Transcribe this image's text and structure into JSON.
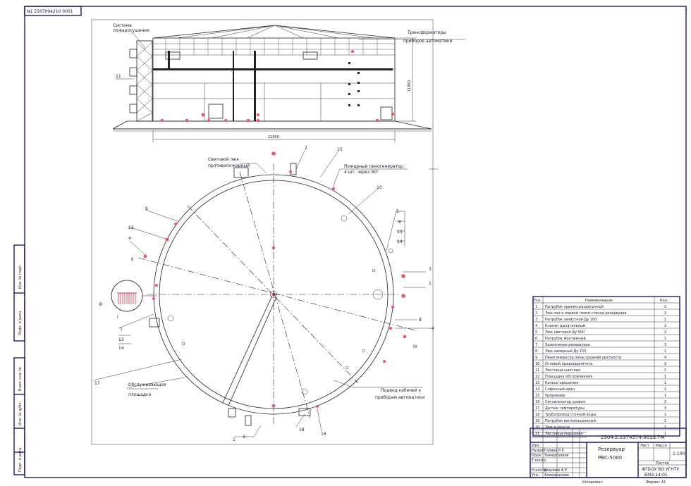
{
  "stamp_top_left": "N1 2567094210 0001",
  "callouts_top": {
    "fire_system": "Система",
    "fire_system_2": "пожаротушения",
    "instrument_trans": "Трансформаторы",
    "instrument_trans_2": "приборов автоматики"
  },
  "callouts_plan": {
    "light_hatch": "Световой люк",
    "light_hatch_2": "противопожарный",
    "fire_nozzle": "Пожарный пеногенератор",
    "fire_nozzle_2": "4 шт. через 90°",
    "ring_pipe": "Обслуживающая",
    "ring_pipe_2": "площадка",
    "cable_line": "Подвод кабелей к",
    "cable_line_2": "приборам автоматики"
  },
  "item_numbers": {
    "n2": "2",
    "n15": "15",
    "n16": "16",
    "n5": "5",
    "n9": "9",
    "n12": "12",
    "n4": "4",
    "n11": "11",
    "n8": "8",
    "n6": "6",
    "n10": "10",
    "n17": "17",
    "n13": "13",
    "n14": "14",
    "n3": "3",
    "n1": "1",
    "n7": "7",
    "n18": "18",
    "roman_iv": "IV",
    "roman_ii": "II",
    "roman_iii": "III",
    "roman_i": "I"
  },
  "spec_table": {
    "header": [
      "Поз.",
      "Наименование",
      "Кол."
    ],
    "rows": [
      [
        "1",
        "Патрубок приемо-раздаточный",
        "2"
      ],
      [
        "2",
        "Люк-лаз в первом поясе стенки резервуара",
        "2"
      ],
      [
        "3",
        "Патрубок зачистной Ду 100",
        "1"
      ],
      [
        "4",
        "Клапан дыхательный",
        "2"
      ],
      [
        "5",
        "Люк световой Ду 500",
        "2"
      ],
      [
        "6",
        "Патрубок монтажный",
        "1"
      ],
      [
        "7",
        "Заземление резервуара",
        "3"
      ],
      [
        "8",
        "Люк замерный Ду 150",
        "1"
      ],
      [
        "9",
        "Пеногенератор пены средней кратности",
        "4"
      ],
      [
        "10",
        "Огневой предохранитель",
        "2"
      ],
      [
        "11",
        "Лестница шахтная",
        "1"
      ],
      [
        "12",
        "Площадка обслуживания",
        "1"
      ],
      [
        "13",
        "Кольцо орошения",
        "1"
      ],
      [
        "14",
        "Сифонный кран",
        "1"
      ],
      [
        "15",
        "Уровнемер",
        "1"
      ],
      [
        "16",
        "Сигнализатор уровня",
        "2"
      ],
      [
        "17",
        "Датчик температуры",
        "3"
      ],
      [
        "18",
        "Трубопровод сточной воды",
        "1"
      ],
      [
        "19",
        "Патрубок вентиляционный",
        "1"
      ],
      [
        "20",
        "Люк в крыше",
        "1"
      ],
      [
        "21",
        "Лестница маршевая",
        "1"
      ]
    ]
  },
  "title_block": {
    "doc_code": "2304.2.2374574.0019.ТМ",
    "title_1": "Резервуар",
    "title_2": "РВС-5000",
    "scale": "1:100",
    "sheet": "Лист",
    "sheets": "Листов",
    "mass": "Масса",
    "org_1": "ФГБОУ ВО УГНТУ",
    "org_2": "БМЗ-14-01",
    "copied": "Копировал",
    "format": "Формат А1",
    "roles": [
      "Изм.",
      "Разраб.",
      "Пров.",
      "Т.контр.",
      "Н.контр.",
      "Утв."
    ],
    "names": [
      "",
      "Галиев Р.Р.",
      "Тимергалиев",
      "",
      "Ялалиев А.Р.",
      "Ахмедгалиев"
    ]
  },
  "left_strip": [
    "Инв. № подл.",
    "Подп. и дата",
    "Взам. инв. №",
    "Инв. № дубл.",
    "Подп. и дата"
  ],
  "dims": {
    "height": "11950",
    "diameter": "22800"
  },
  "colors": {
    "frame": "#1a1a66",
    "ink": "#222222",
    "marker": "#ee5566"
  }
}
